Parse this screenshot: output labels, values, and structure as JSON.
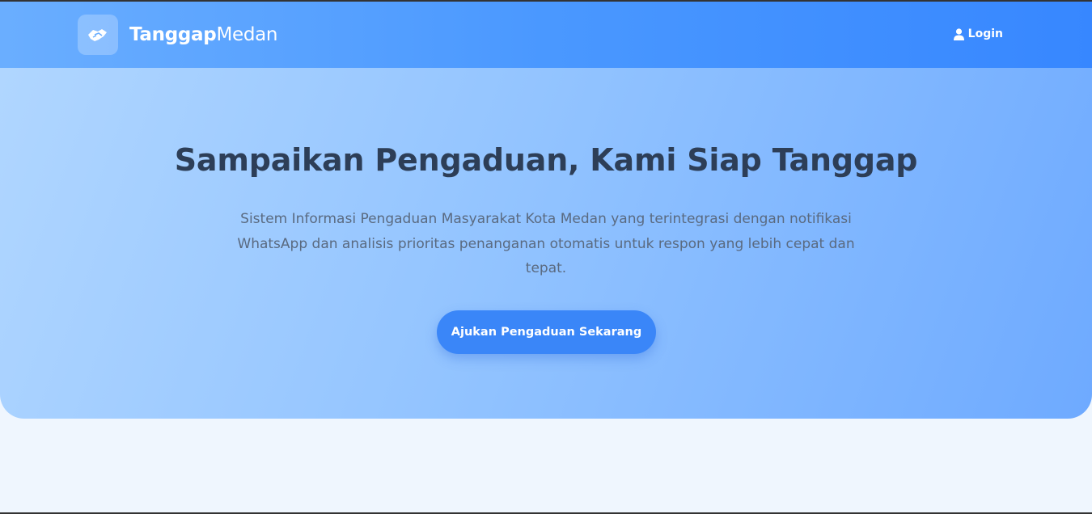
{
  "header": {
    "brand_bold": "Tanggap",
    "brand_light": "Medan",
    "logo_icon": "handshake-icon",
    "login_label": "Login",
    "login_icon": "user-icon"
  },
  "hero": {
    "title": "Sampaikan Pengaduan, Kami Siap Tanggap",
    "description": "Sistem Informasi Pengaduan Masyarakat Kota Medan yang terintegrasi dengan notifikasi WhatsApp dan analisis prioritas penanganan otomatis untuk respon yang lebih cepat dan tepat.",
    "cta_label": "Ajukan Pengaduan Sekarang"
  },
  "colors": {
    "navbar": "#4a98ff",
    "hero": "#93c4ff",
    "primary_button": "#3a86f8",
    "title": "#2d3e57",
    "background": "#eff6fe"
  }
}
